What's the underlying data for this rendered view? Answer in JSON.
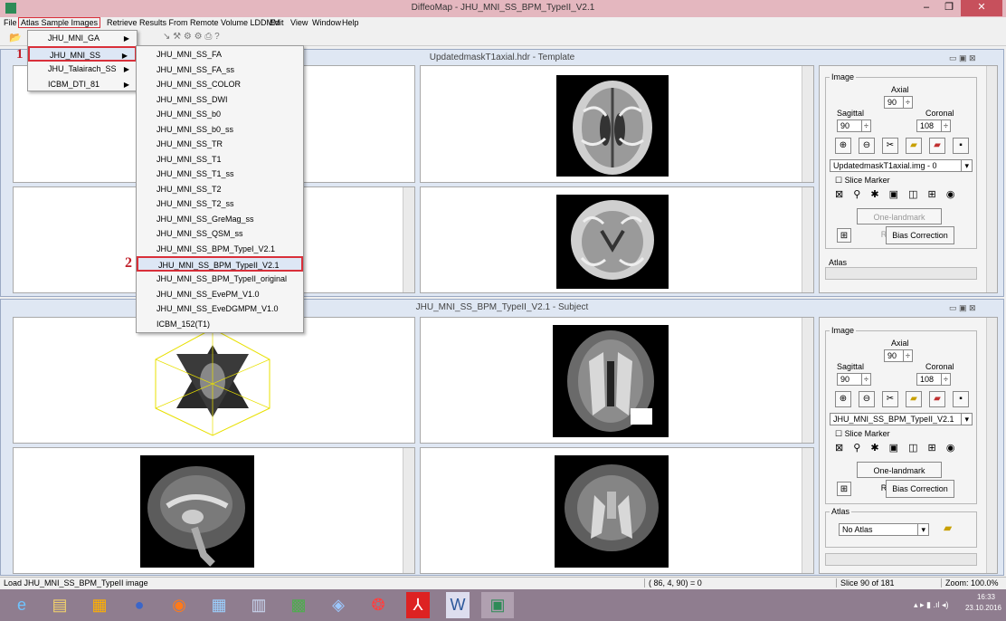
{
  "window": {
    "title": "DiffeoMap - JHU_MNI_SS_BPM_TypeII_V2.1"
  },
  "menubar": [
    "File",
    "Atlas Sample Images",
    "Retrieve Results From Remote Volume LDDMM",
    "Edit",
    "View",
    "Window",
    "Help"
  ],
  "atlas_menu": [
    "JHU_MNI_GA",
    "JHU_MNI_SS",
    "JHU_Talairach_SS",
    "ICBM_DTI_81"
  ],
  "submenu": [
    "JHU_MNI_SS_FA",
    "JHU_MNI_SS_FA_ss",
    "JHU_MNI_SS_COLOR",
    "JHU_MNI_SS_DWI",
    "JHU_MNI_SS_b0",
    "JHU_MNI_SS_b0_ss",
    "JHU_MNI_SS_TR",
    "JHU_MNI_SS_T1",
    "JHU_MNI_SS_T1_ss",
    "JHU_MNI_SS_T2",
    "JHU_MNI_SS_T2_ss",
    "JHU_MNI_SS_GreMag_ss",
    "JHU_MNI_SS_QSM_ss",
    "JHU_MNI_SS_BPM_TypeI_V2.1",
    "JHU_MNI_SS_BPM_TypeII_V2.1",
    "JHU_MNI_SS_BPM_TypeII_original",
    "JHU_MNI_SS_EvePM_V1.0",
    "JHU_MNI_SS_EveDGMPM_V1.0",
    "ICBM_152(T1)"
  ],
  "annotation_1": "1",
  "annotation_2": "2",
  "template": {
    "title": "UpdatedmaskT1axial.hdr - Template",
    "image_label": "Image",
    "axial": "Axial",
    "sagittal": "Sagittal",
    "coronal": "Coronal",
    "axial_val": "90",
    "sagittal_val": "90",
    "coronal_val": "108",
    "image_select": "UpdatedmaskT1axial.img - 0",
    "slice_marker": "Slice Marker",
    "one_landmark": "One-landmark Resample",
    "bias": "Bias Correction",
    "atlas": "Atlas"
  },
  "subject": {
    "title": "JHU_MNI_SS_BPM_TypeII_V2.1 - Subject",
    "image_label": "Image",
    "axial": "Axial",
    "sagittal": "Sagittal",
    "coronal": "Coronal",
    "axial_val": "90",
    "sagittal_val": "90",
    "coronal_val": "108",
    "image_select": "JHU_MNI_SS_BPM_TypeII_V2.1",
    "slice_marker": "Slice Marker",
    "one_landmark": "One-landmark Resample",
    "bias": "Bias Correction",
    "atlas": "Atlas",
    "atlas_select": "No Atlas"
  },
  "status": {
    "left": "Load JHU_MNI_SS_BPM_TypeII image",
    "coords": "( 86,  4,  90) = 0",
    "slice": "Slice 90 of 181",
    "zoom": "Zoom: 100.0%"
  },
  "clock": {
    "time": "16:33",
    "date": "23.10.2016"
  }
}
